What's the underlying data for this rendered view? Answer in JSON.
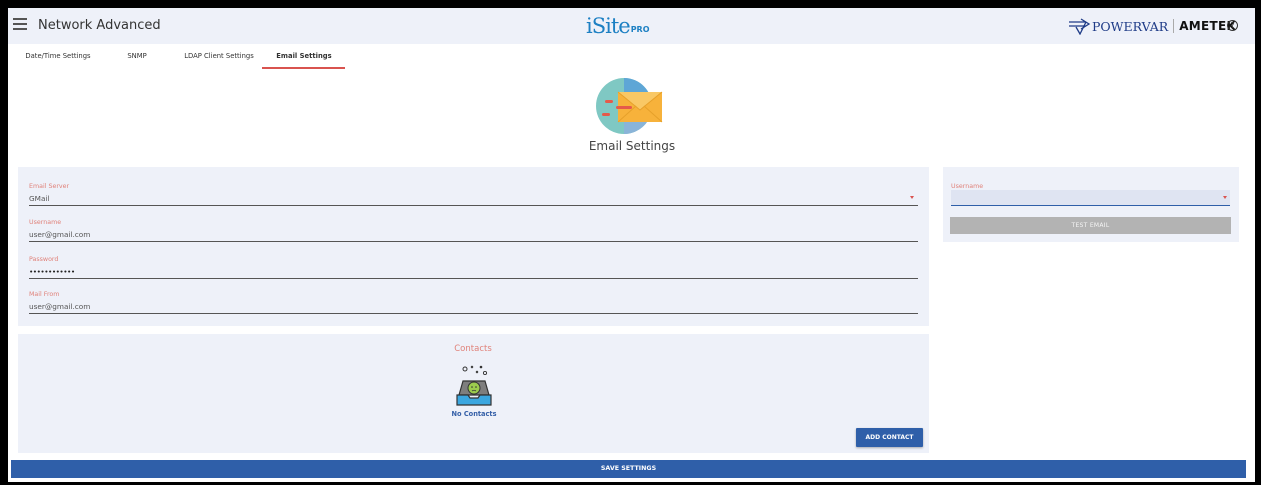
{
  "header": {
    "title": "Network Advanced",
    "logo_main": "iSite",
    "logo_suffix": "PRO",
    "brand_primary": "POWERVAR",
    "brand_secondary": "AMETEK",
    "help_glyph": "?"
  },
  "tabs": [
    {
      "label": "Date/Time Settings",
      "active": false
    },
    {
      "label": "SNMP",
      "active": false
    },
    {
      "label": "LDAP Client Settings",
      "active": false
    },
    {
      "label": "Email Settings",
      "active": true
    }
  ],
  "hero": {
    "title": "Email Settings",
    "icon": "email-icon"
  },
  "form": {
    "email_server": {
      "label": "Email Server",
      "value": "GMail"
    },
    "username": {
      "label": "Username",
      "value": "user@gmail.com"
    },
    "password": {
      "label": "Password",
      "value": "••••••••••••"
    },
    "mail_from": {
      "label": "Mail From",
      "value": "user@gmail.com"
    }
  },
  "test": {
    "username_label": "Username",
    "username_value": "",
    "button_label": "TEST EMAIL"
  },
  "contacts": {
    "title": "Contacts",
    "empty_text": "No Contacts",
    "add_button": "ADD CONTACT"
  },
  "footer": {
    "save_button": "SAVE SETTINGS"
  },
  "colors": {
    "accent": "#2f5fa9",
    "label": "#e0827a",
    "panel": "#eef1f9",
    "tab_underline": "#d9534f"
  }
}
